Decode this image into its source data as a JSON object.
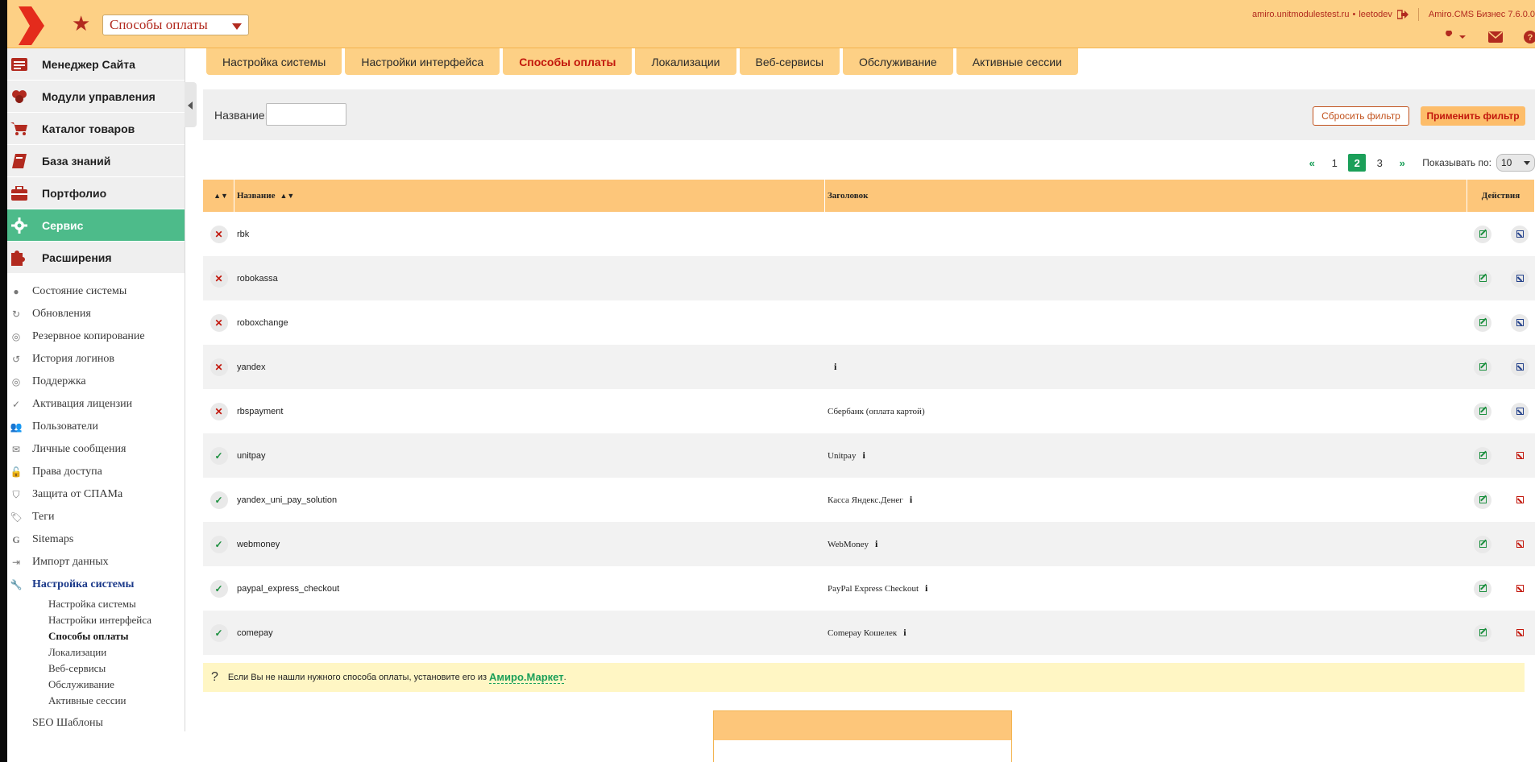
{
  "header": {
    "module_select": "Способы оплаты",
    "site": "amiro.unitmodulestest.ru",
    "separator_dot": "•",
    "user": "leetodev",
    "product": "Amiro.CMS Бизнес 7.6.0.0",
    "icons": [
      "wrench-icon",
      "mail-icon",
      "help-icon"
    ]
  },
  "sidebar": {
    "sections": [
      {
        "label": "Менеджер Сайта",
        "icon": "site-manager-icon"
      },
      {
        "label": "Модули управления",
        "icon": "modules-icon"
      },
      {
        "label": "Каталог товаров",
        "icon": "cart-icon"
      },
      {
        "label": "База знаний",
        "icon": "book-icon"
      },
      {
        "label": "Портфолио",
        "icon": "briefcase-icon"
      },
      {
        "label": "Сервис",
        "icon": "gear-icon"
      },
      {
        "label": "Расширения",
        "icon": "puzzle-icon"
      }
    ],
    "service_items": [
      "Состояние системы",
      "Обновления",
      "Резервное копирование",
      "История логинов",
      "Поддержка",
      "Активация лицензии",
      "Пользователи",
      "Личные сообщения",
      "Права доступа",
      "Защита от СПАМа",
      "Теги",
      "Sitemaps",
      "Импорт данных",
      "Настройка системы"
    ],
    "settings_items": [
      "Настройка системы",
      "Настройки интерфейса",
      "Способы оплаты",
      "Локализации",
      "Веб-сервисы",
      "Обслуживание",
      "Активные сессии"
    ],
    "seo": "SEO Шаблоны"
  },
  "tabs": [
    "Настройка системы",
    "Настройки интерфейса",
    "Способы оплаты",
    "Локализации",
    "Веб-сервисы",
    "Обслуживание",
    "Активные сессии"
  ],
  "filter": {
    "name_label": "Название:",
    "name_value": "",
    "reset": "Сбросить фильтр",
    "apply": "Применить фильтр"
  },
  "pager": {
    "prev": "«",
    "pages": [
      "1",
      "2",
      "3"
    ],
    "current": "2",
    "next": "»",
    "per_page_label": "Показывать по:",
    "per_page": "10"
  },
  "table": {
    "col_name": "Название",
    "col_title": "Заголовок",
    "col_actions": "Действия",
    "rows": [
      {
        "name": "rbk",
        "title": "",
        "info": false,
        "active": false
      },
      {
        "name": "robokassa",
        "title": "",
        "info": false,
        "active": false
      },
      {
        "name": "roboxchange",
        "title": "",
        "info": false,
        "active": false
      },
      {
        "name": "yandex",
        "title": "",
        "info": true,
        "active": false
      },
      {
        "name": "rbspayment",
        "title": "Сбербанк (оплата картой)",
        "info": false,
        "active": false
      },
      {
        "name": "unitpay",
        "title": "Unitpay",
        "info": true,
        "active": true
      },
      {
        "name": "yandex_uni_pay_solution",
        "title": "Касса Яндекс.Денег",
        "info": true,
        "active": true
      },
      {
        "name": "webmoney",
        "title": "WebMoney",
        "info": true,
        "active": true
      },
      {
        "name": "paypal_express_checkout",
        "title": "PayPal Express Checkout",
        "info": true,
        "active": true
      },
      {
        "name": "comepay",
        "title": "Comepay Кошелек",
        "info": true,
        "active": true
      }
    ]
  },
  "hint": {
    "q": "?",
    "text": "Если Вы не нашли нужного способа оплаты, установите его из",
    "market": "Амиро.Маркет",
    "tail": "."
  },
  "colors": {
    "header_bg": "#fdd085",
    "accent_red": "#c2170c",
    "active_green": "#4dbb8a",
    "pager_green": "#1b9f59"
  }
}
